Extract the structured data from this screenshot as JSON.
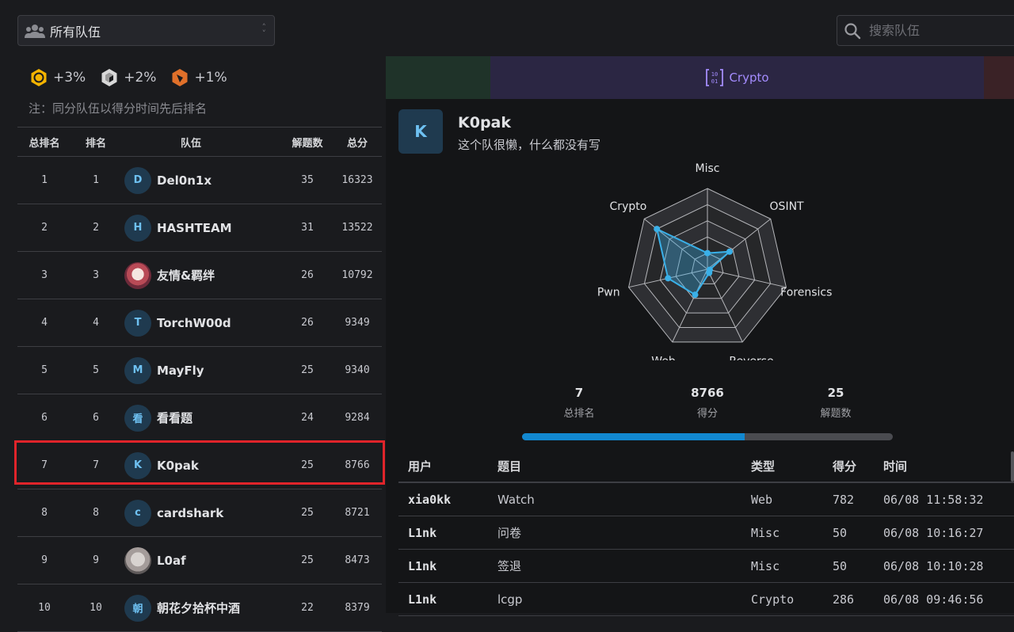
{
  "filter": {
    "team_select_value": "所有队伍",
    "search_placeholder": "搜索队伍"
  },
  "bonus": [
    {
      "label": "+3%",
      "color": "#f5b400",
      "icon": "gold-medal-icon"
    },
    {
      "label": "+2%",
      "color": "#d8d8d8",
      "icon": "silver-medal-icon"
    },
    {
      "label": "+1%",
      "color": "#e0702a",
      "icon": "bronze-medal-icon"
    }
  ],
  "note": "注：同分队伍以得分时间先后排名",
  "ranking": {
    "headers": {
      "overall": "总排名",
      "rank": "排名",
      "team": "队伍",
      "solved": "解题数",
      "score": "总分"
    },
    "rows": [
      {
        "overall": "1",
        "rank": "1",
        "avatar": "D",
        "team": "Del0n1x",
        "solved": "35",
        "score": "16323"
      },
      {
        "overall": "2",
        "rank": "2",
        "avatar": "H",
        "team": "HASHTEAM",
        "solved": "31",
        "score": "13522"
      },
      {
        "overall": "3",
        "rank": "3",
        "avatar": "",
        "team": "友情&羁绊",
        "solved": "26",
        "score": "10792"
      },
      {
        "overall": "4",
        "rank": "4",
        "avatar": "T",
        "team": "TorchW00d",
        "solved": "26",
        "score": "9349"
      },
      {
        "overall": "5",
        "rank": "5",
        "avatar": "M",
        "team": "MayFly",
        "solved": "25",
        "score": "9340"
      },
      {
        "overall": "6",
        "rank": "6",
        "avatar": "看",
        "team": "看看题",
        "solved": "24",
        "score": "9284"
      },
      {
        "overall": "7",
        "rank": "7",
        "avatar": "K",
        "team": "K0pak",
        "solved": "25",
        "score": "8766"
      },
      {
        "overall": "8",
        "rank": "8",
        "avatar": "c",
        "team": "cardshark",
        "solved": "25",
        "score": "8721"
      },
      {
        "overall": "9",
        "rank": "9",
        "avatar": "",
        "team": "L0af",
        "solved": "25",
        "score": "8473"
      },
      {
        "overall": "10",
        "rank": "10",
        "avatar": "朝",
        "team": "朝花夕拾杯中酒",
        "solved": "22",
        "score": "8379"
      }
    ]
  },
  "category_bar": {
    "active_label": "Crypto",
    "colors": [
      "#1f3329",
      "#2b2643",
      "#3a2226"
    ]
  },
  "team_detail": {
    "avatar": "K",
    "name": "K0pak",
    "bio": "这个队很懒，什么都没有写",
    "radar": {
      "axes": [
        "Misc",
        "OSINT",
        "Forensics",
        "Reverse",
        "Web",
        "Pwn",
        "Crypto"
      ],
      "values": [
        0.2,
        0.35,
        0.03,
        0.05,
        0.35,
        0.5,
        0.8
      ]
    },
    "stats": [
      {
        "value": "7",
        "label": "总排名"
      },
      {
        "value": "8766",
        "label": "得分"
      },
      {
        "value": "25",
        "label": "解题数"
      }
    ],
    "progress": 0.6
  },
  "solves": {
    "headers": {
      "user": "用户",
      "challenge": "题目",
      "type": "类型",
      "score": "得分",
      "time": "时间"
    },
    "rows": [
      {
        "user": "xia0kk",
        "challenge": "Watch",
        "type": "Web",
        "score": "782",
        "time": "06/08 11:58:32"
      },
      {
        "user": "L1nk",
        "challenge": "问卷",
        "type": "Misc",
        "score": "50",
        "time": "06/08 10:16:27"
      },
      {
        "user": "L1nk",
        "challenge": "签退",
        "type": "Misc",
        "score": "50",
        "time": "06/08 10:10:28"
      },
      {
        "user": "L1nk",
        "challenge": "lcgp",
        "type": "Crypto",
        "score": "286",
        "time": "06/08 09:46:56"
      }
    ]
  }
}
